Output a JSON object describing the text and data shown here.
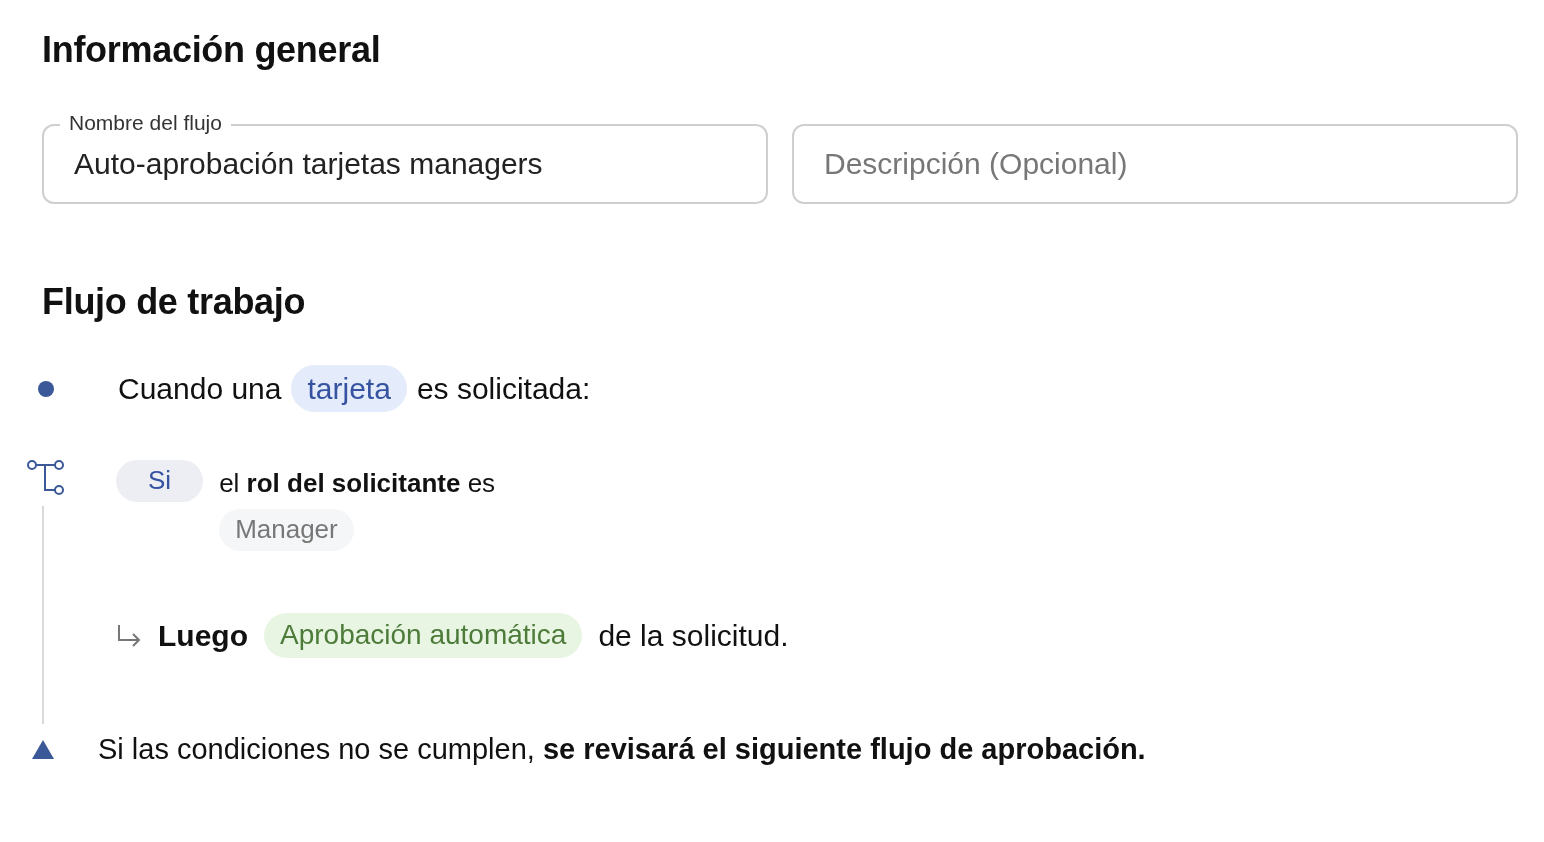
{
  "general": {
    "heading": "Información general",
    "fields": [
      {
        "label": "Nombre del flujo",
        "value": "Auto-aprobación tarjetas managers"
      },
      {
        "placeholder": "Descripción (Opcional)"
      }
    ]
  },
  "workflow": {
    "heading": "Flujo de trabajo",
    "trigger": {
      "before": "Cuando una",
      "chip": {
        "kind": "entity",
        "text": "tarjeta"
      },
      "after": "es solicitada:"
    },
    "condition": {
      "chip": {
        "kind": "condition",
        "text": "Si"
      },
      "sentence": "el **rol del solicitante** es",
      "value": {
        "kind": "value",
        "text": "Manager"
      }
    },
    "action": {
      "lead": "Luego",
      "chip": {
        "kind": "action",
        "text": "Aprobación automática"
      },
      "after": "de la solicitud."
    },
    "fallback": "Si las condiciones no se cumplen, **se revisará el siguiente flujo de aprobación.**"
  }
}
